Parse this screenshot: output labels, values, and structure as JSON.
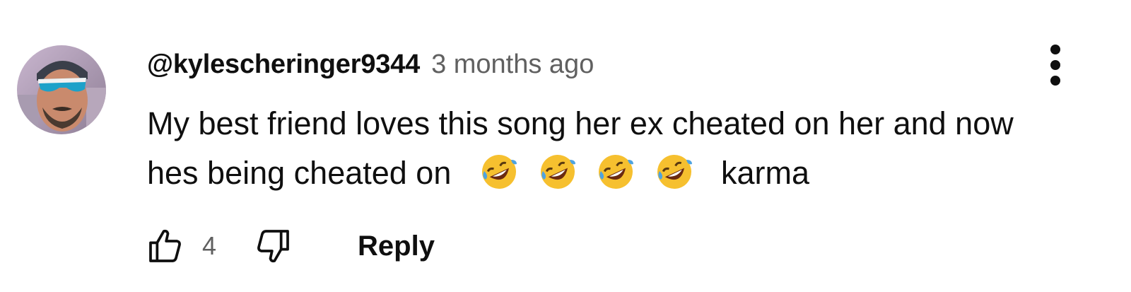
{
  "comment": {
    "author": "@kylescheringer9344",
    "time": "3 months ago",
    "text_line1": "My best friend loves this song her ex cheated on her and now",
    "text_line2_before": "hes being cheated on",
    "text_line2_after": "karma",
    "emojis": [
      "rolling-on-floor-laughing",
      "rolling-on-floor-laughing",
      "rolling-on-floor-laughing",
      "rolling-on-floor-laughing"
    ],
    "like_count": "4",
    "reply_label": "Reply"
  },
  "colors": {
    "text_primary": "#0f0f0f",
    "text_secondary": "#606060",
    "background": "#ffffff",
    "emoji_face": "#f6c02f",
    "emoji_tear": "#4fa3e0"
  },
  "icons": {
    "avatar": "user-avatar",
    "like": "thumb-up-icon",
    "dislike": "thumb-down-icon",
    "menu": "more-vert-icon"
  }
}
